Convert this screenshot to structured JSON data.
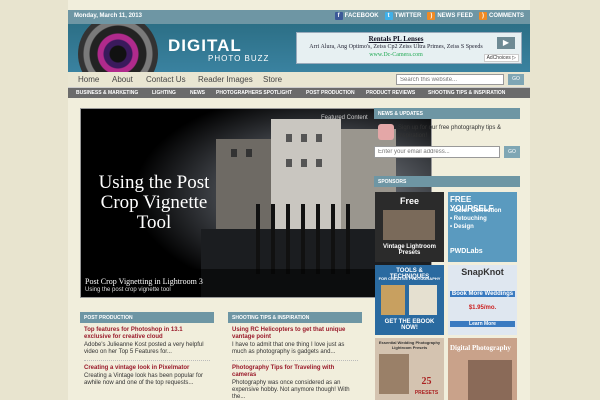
{
  "topbar": {
    "date": "Monday, March 11, 2013",
    "links": [
      "FACEBOOK",
      "TWITTER",
      "NEWS FEED",
      "COMMENTS"
    ]
  },
  "header": {
    "logo_main": "DIGITAL",
    "logo_sub": "PHOTO BUZZ",
    "ad": {
      "title": "Rentals PL Lenses",
      "line": "Arri Alura, Ang Optimo's, Zeiss Cp2 Zeiss Ultra Primes, Zeiss S Speeds",
      "url": "www.Dc-Camera.com",
      "choices": "AdChoices ▷"
    }
  },
  "nav": {
    "items": [
      "Home",
      "About",
      "Contact Us",
      "Reader Images",
      "Store"
    ],
    "search_placeholder": "Search this website...",
    "go": "GO"
  },
  "subnav": {
    "items": [
      "BUSINESS & MARKETING",
      "LIGHTING",
      "NEWS",
      "PHOTOGRAPHERS SPOTLIGHT",
      "POST PRODUCTION",
      "PRODUCT REVIEWS",
      "SHOOTING TIPS & INSPIRATION"
    ]
  },
  "featured": {
    "label": "Featured Content",
    "title": "Using the Post Crop Vignette Tool",
    "caption": "Post Crop Vignetting in Lightroom 3",
    "sub": "Using the post crop vignette tool"
  },
  "columns": [
    {
      "head": "POST PRODUCTION",
      "posts": [
        {
          "title": "Top features for Photoshop in 13.1 exclusive for creative cloud",
          "excerpt": "Adobe's Julieanne Kost posted a very helpful video on her Top 5 Features for..."
        },
        {
          "title": "Creating a vintage look in Pixelmator",
          "excerpt": "Creating a Vintage look has been popular for awhile now and one of the top requests..."
        }
      ]
    },
    {
      "head": "SHOOTING TIPS & INSPIRATION",
      "posts": [
        {
          "title": "Using RC Helicopters to get that unique vantage point",
          "excerpt": "I have to admit that one thing I love just as much as photography is gadgets and..."
        },
        {
          "title": "Photography Tips for Traveling with cameras",
          "excerpt": "Photography was once considered as an expensive hobby. Not anymore though! With the..."
        }
      ]
    }
  ],
  "sidebar": {
    "news_head": "NEWS & UPDATES",
    "news_text": "Sign up for our free photography tips & inspiration!",
    "email_placeholder": "Enter your email address...",
    "go": "GO",
    "sponsors_head": "SPONSORS",
    "sponsors": [
      {
        "lines": [
          "Free",
          "Vintage Lightroom Presets"
        ]
      },
      {
        "lines": [
          "FREE YOURSELF",
          "• Color Correction",
          "• Retouching",
          "• Design",
          "PWDLabs"
        ]
      },
      {
        "lines": [
          "TOOLS & TECHNIQUES",
          "FOR CREATIVE PHOTOGRAPHY",
          "GET THE EBOOK NOW!"
        ]
      },
      {
        "lines": [
          "SnapKnot",
          "Book More Weddings",
          "$1.95/mo.",
          "Learn More"
        ]
      },
      {
        "lines": [
          "Essential Wedding Photography Lightroom Presets",
          "25",
          "PRESETS"
        ]
      },
      {
        "lines": [
          "Digital Photography"
        ]
      }
    ]
  },
  "colors": {
    "accent": "#6e96a4",
    "post_title": "#9a1a2a"
  }
}
